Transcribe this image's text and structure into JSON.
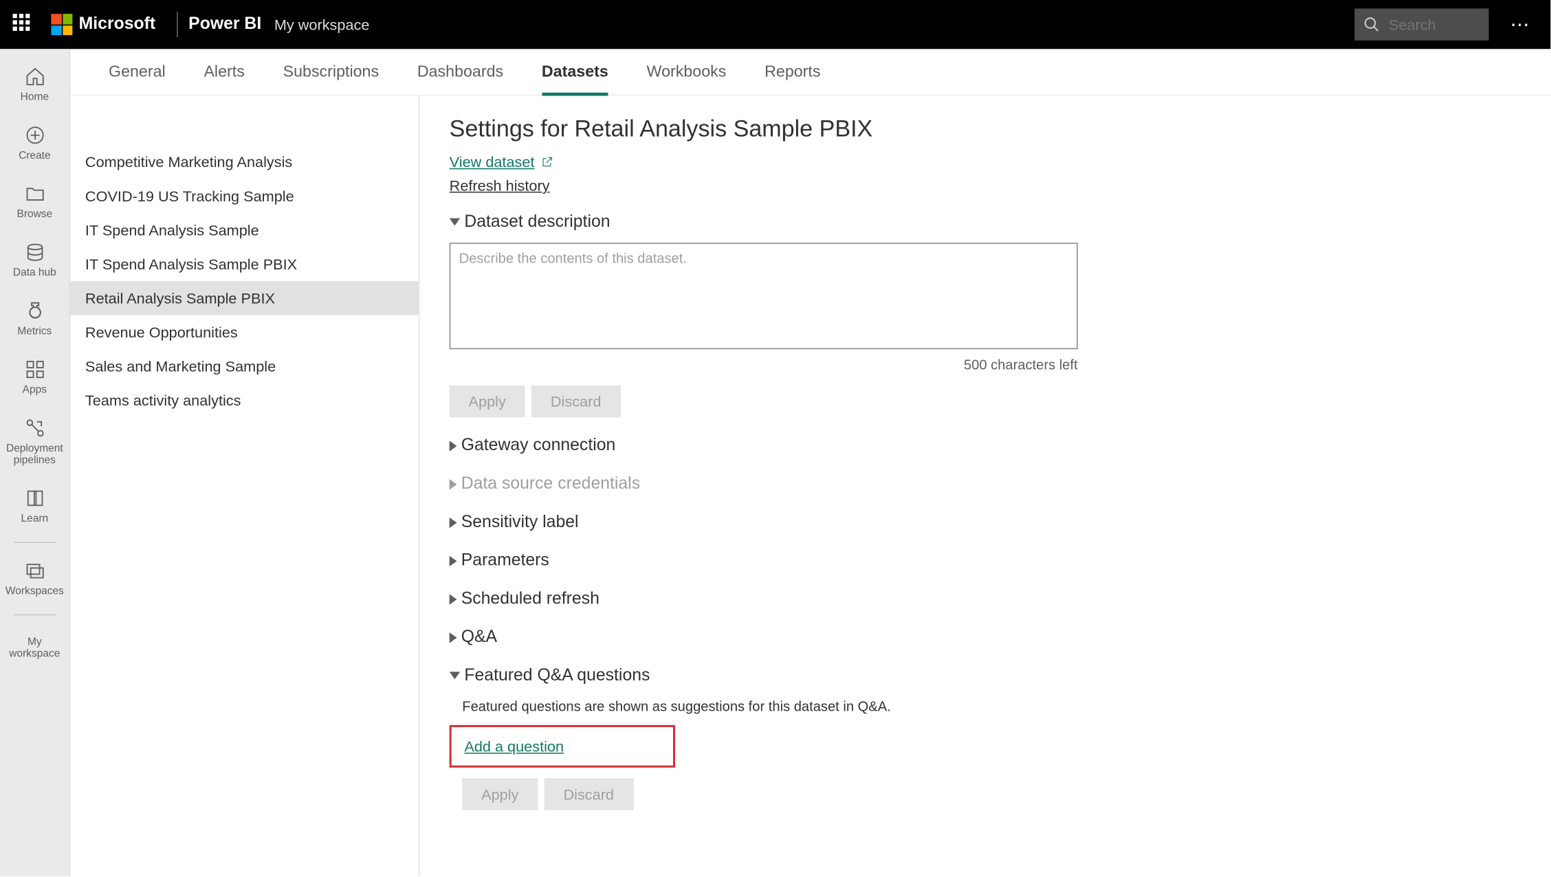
{
  "topbar": {
    "ms_text": "Microsoft",
    "product": "Power BI",
    "workspace": "My workspace",
    "search_placeholder": "Search"
  },
  "nav": {
    "items": [
      {
        "label": "Home",
        "icon": "home-icon"
      },
      {
        "label": "Create",
        "icon": "create-icon"
      },
      {
        "label": "Browse",
        "icon": "browse-icon"
      },
      {
        "label": "Data hub",
        "icon": "datahub-icon"
      },
      {
        "label": "Metrics",
        "icon": "metrics-icon"
      },
      {
        "label": "Apps",
        "icon": "apps-icon"
      },
      {
        "label": "Deployment pipelines",
        "icon": "pipelines-icon"
      },
      {
        "label": "Learn",
        "icon": "learn-icon"
      },
      {
        "label": "Workspaces",
        "icon": "workspaces-icon"
      }
    ],
    "my_workspace": "My workspace"
  },
  "tabs": {
    "items": [
      "General",
      "Alerts",
      "Subscriptions",
      "Dashboards",
      "Datasets",
      "Workbooks",
      "Reports"
    ],
    "active": "Datasets"
  },
  "datasets_list": {
    "items": [
      "Competitive Marketing Analysis",
      "COVID-19 US Tracking Sample",
      "IT Spend Analysis Sample",
      "IT Spend Analysis Sample PBIX",
      "Retail Analysis Sample PBIX",
      "Revenue Opportunities",
      "Sales and Marketing Sample",
      "Teams activity analytics"
    ],
    "selected": "Retail Analysis Sample PBIX"
  },
  "settings": {
    "title": "Settings for Retail Analysis Sample PBIX",
    "view_dataset": "View dataset",
    "refresh_history": "Refresh history",
    "sections": {
      "description": "Dataset description",
      "gateway": "Gateway connection",
      "credentials": "Data source credentials",
      "sensitivity": "Sensitivity label",
      "parameters": "Parameters",
      "scheduled": "Scheduled refresh",
      "qa": "Q&A",
      "featured": "Featured Q&A questions"
    },
    "desc_placeholder": "Describe the contents of this dataset.",
    "chars_left": "500 characters left",
    "apply": "Apply",
    "discard": "Discard",
    "featured_help": "Featured questions are shown as suggestions for this dataset in Q&A.",
    "add_question": "Add a question"
  }
}
